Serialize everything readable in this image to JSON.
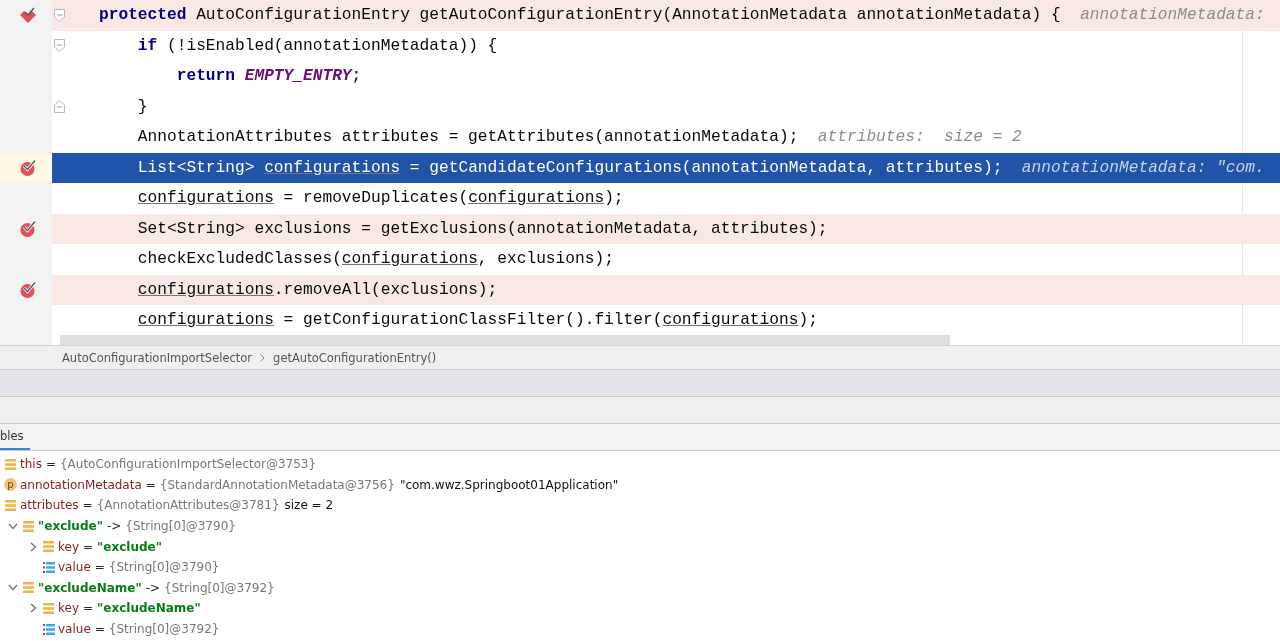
{
  "editor": {
    "lines": [
      {
        "kind": "method_breakpoint",
        "selected": false,
        "fold": {
          "kind": "start"
        },
        "tokens": [
          {
            "kind": "keyword",
            "text": "protected"
          },
          {
            "kind": "plain",
            "text": " AutoConfigurationEntry getAutoConfigurationEntry(AnnotationMetadata annotationMetadata) {"
          }
        ],
        "hint": "annotationMetadata:",
        "children": [
          {
            "kind": "code",
            "selected": false,
            "fold": {
              "kind": "start"
            },
            "tokens": [
              {
                "kind": "keyword",
                "text": "if"
              },
              {
                "kind": "plain",
                "text": " (!isEnabled(annotationMetadata)) {"
              }
            ],
            "children": [
              {
                "kind": "code",
                "selected": false,
                "tokens": [
                  {
                    "kind": "keyword",
                    "text": "return"
                  },
                  {
                    "kind": "constant",
                    "text": " EMPTY_ENTRY"
                  },
                  {
                    "kind": "plain",
                    "text": ";"
                  }
                ]
              }
            ]
          },
          {
            "kind": "code",
            "selected": false,
            "fold": {
              "kind": "end"
            },
            "tokens": [
              {
                "kind": "plain",
                "text": "}"
              }
            ]
          },
          {
            "kind": "code",
            "selected": false,
            "tokens": [
              {
                "kind": "plain",
                "text": "AnnotationAttributes attributes = getAttributes(annotationMetadata);"
              }
            ],
            "hint": "attributes:  size = 2"
          },
          {
            "kind": "line_breakpoint",
            "selected": true,
            "tokens": [
              {
                "kind": "plain",
                "text": "List<String> "
              },
              {
                "kind": "variable",
                "text": "configurations"
              },
              {
                "kind": "plain",
                "text": " = getCandidateConfigurations(annotationMetadata, attributes);"
              }
            ],
            "hint": "annotationMetadata: \"com."
          },
          {
            "kind": "code",
            "selected": false,
            "tokens": [
              {
                "kind": "variable",
                "text": "configurations"
              },
              {
                "kind": "plain",
                "text": " = removeDuplicates("
              },
              {
                "kind": "variable",
                "text": "configurations"
              },
              {
                "kind": "plain",
                "text": ");"
              }
            ]
          },
          {
            "kind": "line_breakpoint",
            "selected": false,
            "tokens": [
              {
                "kind": "plain",
                "text": "Set<String> exclusions = getExclusions(annotationMetadata, attributes);"
              }
            ]
          },
          {
            "kind": "code",
            "selected": false,
            "tokens": [
              {
                "kind": "plain",
                "text": "checkExcludedClasses("
              },
              {
                "kind": "variable",
                "text": "configurations"
              },
              {
                "kind": "plain",
                "text": ", exclusions);"
              }
            ]
          },
          {
            "kind": "line_breakpoint",
            "selected": false,
            "tokens": [
              {
                "kind": "variable",
                "text": "configurations"
              },
              {
                "kind": "plain",
                "text": ".removeAll(exclusions);"
              }
            ]
          },
          {
            "kind": "code",
            "selected": false,
            "tokens": [
              {
                "kind": "variable",
                "text": "configurations"
              },
              {
                "kind": "plain",
                "text": " = getConfigurationClassFilter().filter("
              },
              {
                "kind": "variable",
                "text": "configurations"
              },
              {
                "kind": "plain",
                "text": ");"
              }
            ]
          }
        ]
      }
    ]
  },
  "breadcrumbs": [
    "AutoConfigurationImportSelector",
    "getAutoConfigurationEntry()"
  ],
  "tabs": [
    {
      "label": "bles",
      "selected": true
    }
  ],
  "variables": [
    {
      "kind": "field",
      "name": {
        "kind": "field",
        "text": "this"
      },
      "operator": "=",
      "value": {
        "kind": "object",
        "text": "{AutoConfigurationImportSelector@3753}"
      }
    },
    {
      "kind": "parameter",
      "icon_text": "p",
      "name": {
        "kind": "field",
        "text": "annotationMetadata"
      },
      "operator": "=",
      "value": {
        "kind": "object",
        "text": "{StandardAnnotationMetadata@3756}"
      },
      "extra": "\"com.wwz.Springboot01Application\""
    },
    {
      "kind": "field",
      "name": {
        "kind": "field",
        "text": "attributes"
      },
      "operator": "=",
      "value": {
        "kind": "object",
        "text": "{AnnotationAttributes@3781}"
      },
      "extra": "size = 2",
      "children": [
        {
          "kind": "field",
          "expanded": true,
          "name": {
            "kind": "string",
            "text": "\"exclude\""
          },
          "operator": "->",
          "value": {
            "kind": "object",
            "text": "{String[0]@3790}"
          },
          "children": [
            {
              "kind": "field",
              "expanded": false,
              "name": {
                "kind": "field",
                "text": "key"
              },
              "operator": "=",
              "value": {
                "kind": "string",
                "text": "\"exclude\""
              }
            },
            {
              "kind": "array",
              "name": {
                "kind": "field",
                "text": "value"
              },
              "operator": "=",
              "value": {
                "kind": "object",
                "text": "{String[0]@3790}"
              }
            }
          ]
        },
        {
          "kind": "field",
          "expanded": true,
          "name": {
            "kind": "string",
            "text": "\"excludeName\""
          },
          "operator": "->",
          "value": {
            "kind": "object",
            "text": "{String[0]@3792}"
          },
          "children": [
            {
              "kind": "field",
              "expanded": false,
              "name": {
                "kind": "field",
                "text": "key"
              },
              "operator": "=",
              "value": {
                "kind": "string",
                "text": "\"excludeName\""
              }
            },
            {
              "kind": "array",
              "name": {
                "kind": "field",
                "text": "value"
              },
              "operator": "=",
              "value": {
                "kind": "object",
                "text": "{String[0]@3792}"
              }
            }
          ]
        }
      ]
    }
  ]
}
